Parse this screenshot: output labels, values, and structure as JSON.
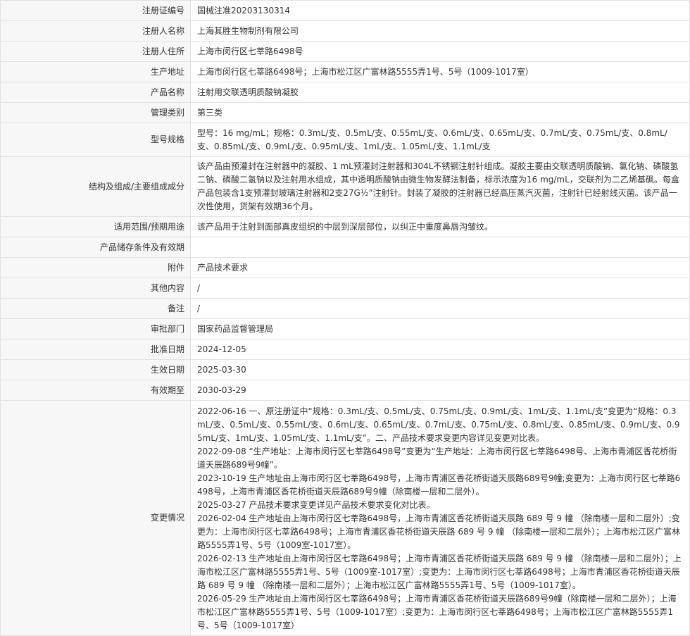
{
  "fields": [
    {
      "label": "注册证编号",
      "value": "国械注准20203130314"
    },
    {
      "label": "注册人名称",
      "value": "上海其胜生物制剂有限公司"
    },
    {
      "label": "注册人住所",
      "value": "上海市闵行区七莘路6498号"
    },
    {
      "label": "生产地址",
      "value": "上海市闵行区七莘路6498号；上海市松江区广富林路5555弄1号、5号（1009-1017室）"
    },
    {
      "label": "产品名称",
      "value": "注射用交联透明质酸钠凝胶"
    },
    {
      "label": "管理类别",
      "value": "第三类"
    },
    {
      "label": "型号规格",
      "value": "型号：16 mg/mL；规格：0.3mL/支、0.5mL/支、0.55mL/支、0.6mL/支、0.65mL/支、0.7mL/支、0.75mL/支、0.8mL/支、0.85mL/支、0.9mL/支、0.95mL/支、1mL/支、1.05mL/支、1.1mL/支"
    },
    {
      "label": "结构及组成/主要组成成分",
      "value": "该产品由预灌封在注射器中的凝胶、1 mL预灌封注射器和304L不锈钢注射针组成。凝胶主要由交联透明质酸钠、氯化钠、磷酸氢二钠、磷酸二氢钠以及注射用水组成，其中透明质酸钠由微生物发酵法制备，标示浓度为16 mg/mL，交联剂为二乙烯基砜。每盒产品包装含1支预灌封玻璃注射器和2支27G½”注射针。封装了凝胶的注射器已经高压蒸汽灭菌，注射针已经射线灭菌。该产品一次性使用，货架有效期36个月。"
    },
    {
      "label": "适用范围/预期用途",
      "value": "该产品用于注射到面部真皮组织的中层到深层部位，以纠正中重度鼻唇沟皱纹。"
    },
    {
      "label": "产品储存条件及有效期",
      "value": ""
    },
    {
      "label": "附件",
      "value": "产品技术要求"
    },
    {
      "label": "其他内容",
      "value": "/"
    },
    {
      "label": "备注",
      "value": "/"
    },
    {
      "label": "审批部门",
      "value": "国家药品监督管理局"
    },
    {
      "label": "批准日期",
      "value": "2024-12-05"
    },
    {
      "label": "生效日期",
      "value": "2025-03-30"
    },
    {
      "label": "有效期至",
      "value": "2030-03-29"
    }
  ],
  "changes": {
    "label": "变更情况",
    "entries": [
      "2022-06-16 一、原注册证中“规格：0.3mL/支、0.5mL/支、0.75mL/支、0.9mL/支、1mL/支、1.1mL/支”变更为“规格：0.3mL/支、0.5mL/支、0.55mL/支、0.6mL/支、0.65mL/支、0.7mL/支、0.75mL/支、0.8mL/支、0.85mL/支、0.9mL/支、0.95mL/支、1mL/支、1.05mL/支、1.1mL/支”。二、产品技术要求变更内容详见变更对比表。",
      "2022-09-08 “生产地址：上海市闵行区七莘路6498号”变更为“生产地址：上海市闵行区七莘路6498号、上海市青浦区香花桥街道天辰路689号9幢”。",
      "2023-10-19 生产地址由上海市闵行区七莘路6498号，上海市青浦区香花桥街道天辰路689号9幢;变更为：上海市闵行区七莘路6498号，上海市青浦区香花桥街道天辰路689号9幢（除南楼一层和二层外）。",
      "2025-03-27 产品技术要求变更详见产品技术要求变化对比表。",
      "2026-02-04 生产地址由上海市闵行区七莘路6498号，上海市青浦区香花桥街道天辰路 689 号 9 幢 （除南楼一层和二层外）;变更为：上海市闵行区七莘路6498号；上海市青浦区香花桥街道天辰路 689 号 9 幢 （除南楼一层和二层外）；上海市松江区广富林路5555弄1号、5号（1009室-1017室）。",
      "2026-02-13 生产地址由上海市闵行区七莘路6498号；上海市青浦区香花桥街道天辰路 689 号 9 幢 （除南楼一层和二层外）；上海市松江区广富林路5555弄1号、5号（1009室-1017室）;变更为：上海市闵行区七莘路6498号；上海市青浦区香花桥街道天辰路 689 号 9 幢 （除南楼一层和二层外）；上海市松江区广富林路5555弄1号、5号（1009-1017室）。",
      "2026-05-29 生产地址由上海市闵行区七莘路6498号；上海市青浦区香花桥街道天辰路689号9幢（除南楼一层和二层外）；上海市松江区广富林路5555弄1号、5号（1009-1017室）;变更为：上海市闵行区七莘路6498号；上海市松江区广富林路5555弄1号、5号（1009-1017室）"
    ]
  }
}
